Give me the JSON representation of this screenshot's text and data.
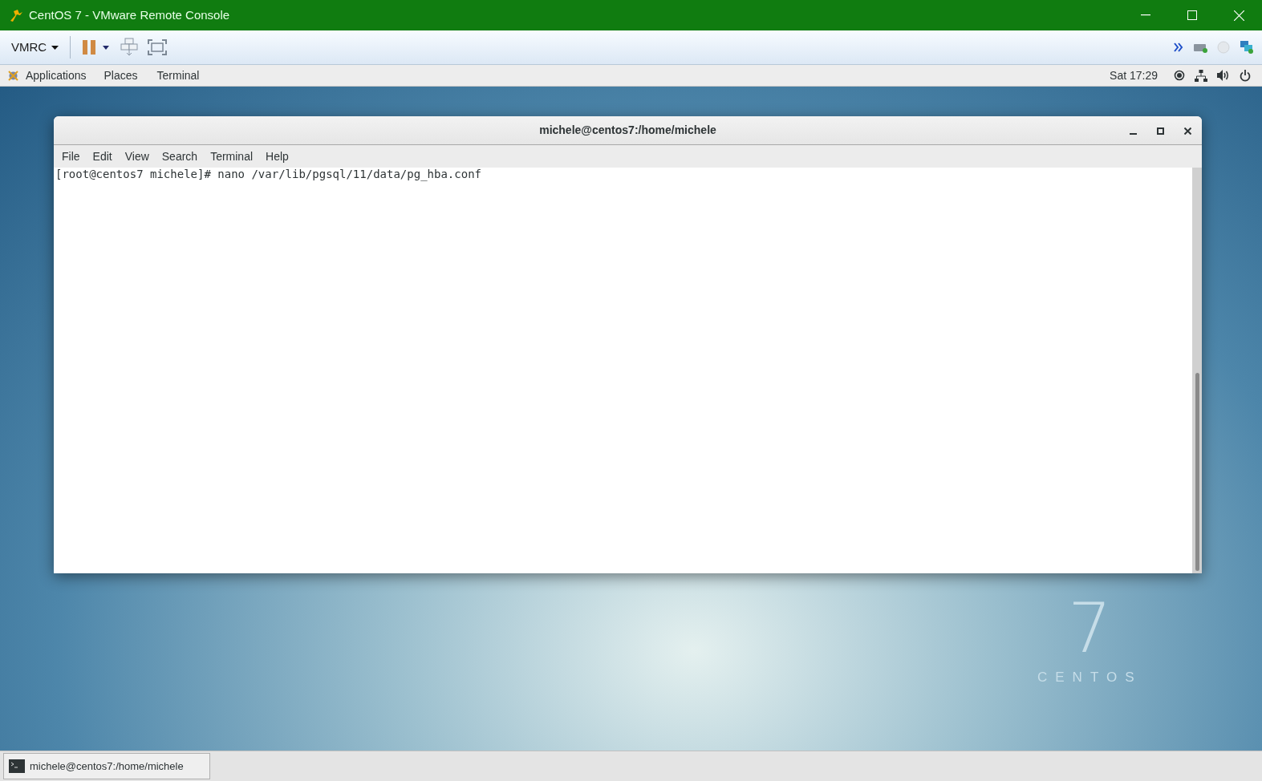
{
  "window": {
    "title": "CentOS 7 - VMware Remote Console"
  },
  "toolbar": {
    "menu": "VMRC"
  },
  "top_bar": {
    "menus": [
      "Applications",
      "Places",
      "Terminal"
    ],
    "clock": "Sat 17:29"
  },
  "terminal": {
    "title": "michele@centos7:/home/michele",
    "menus": [
      "File",
      "Edit",
      "View",
      "Search",
      "Terminal",
      "Help"
    ],
    "lines": [
      "[root@centos7 michele]# nano /var/lib/pgsql/11/data/pg_hba.conf"
    ]
  },
  "desktop_logo": {
    "numeral": "7",
    "name": "CENTOS"
  },
  "taskbar": {
    "items": [
      {
        "label": "michele@centos7:/home/michele",
        "selected": false
      }
    ]
  }
}
